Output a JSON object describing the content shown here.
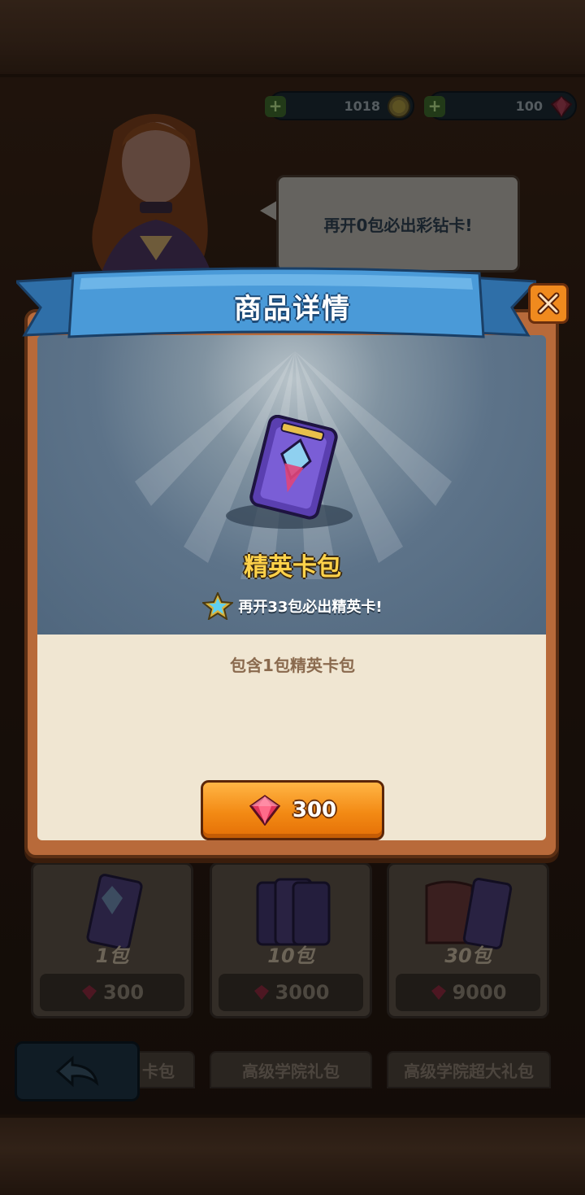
{
  "currency": {
    "gold_amount": "1018",
    "gem_amount": "100",
    "add_label": "+"
  },
  "npc": {
    "speech": "再开0包必出彩钻卡!"
  },
  "shop": {
    "packs": [
      {
        "count": "1包",
        "price": "300"
      },
      {
        "count": "10包",
        "price": "3000"
      },
      {
        "count": "30包",
        "price": "9000"
      }
    ],
    "tabs": [
      "卡包",
      "高级学院礼包",
      "高级学院超大礼包"
    ]
  },
  "modal": {
    "title": "商品详情",
    "item_name": "精英卡包",
    "hint": "再开33包必出精英卡!",
    "description": "包含1包精英卡包",
    "buy_price": "300"
  },
  "colors": {
    "accent_orange": "#f38a14",
    "ribbon_blue": "#3f8fd0",
    "item_gold": "#ffd24a",
    "gem_red": "#e0345a"
  },
  "icons": {
    "close": "close-icon",
    "gem": "gem-icon",
    "gold": "gold-coin-icon",
    "back": "back-arrow-icon",
    "star": "star-icon"
  }
}
